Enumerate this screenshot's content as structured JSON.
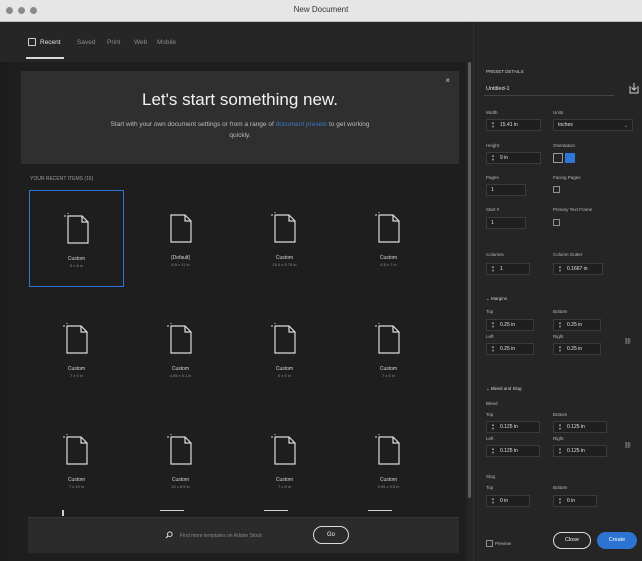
{
  "window": {
    "title": "New Document"
  },
  "tabs": [
    {
      "label": "Recent"
    },
    {
      "label": "Saved"
    },
    {
      "label": "Print"
    },
    {
      "label": "Web"
    },
    {
      "label": "Mobile"
    }
  ],
  "hero": {
    "title": "Let's start something new.",
    "subtitle_before_link": "Start with your own document settings or from a range of ",
    "subtitle_link": "document presets",
    "subtitle_after_link": " to get working quickly."
  },
  "recent": {
    "heading": "YOUR RECENT ITEMS (16)",
    "items": [
      {
        "name": "Custom",
        "size": "5 x 6 in"
      },
      {
        "name": "[Default]",
        "size": "8.5 x 11 in"
      },
      {
        "name": "Custom",
        "size": "15.4 x 9.75 in"
      },
      {
        "name": "Custom",
        "size": "8.5 x 7 in"
      },
      {
        "name": "Custom",
        "size": "7 x 9 in"
      },
      {
        "name": "Custom",
        "size": "4.95 x 6.1 in"
      },
      {
        "name": "Custom",
        "size": "6 x 6 in"
      },
      {
        "name": "Custom",
        "size": "7 x 8 in"
      },
      {
        "name": "Custom",
        "size": "7 x 10 in"
      },
      {
        "name": "Custom",
        "size": "10 x 8.5 in"
      },
      {
        "name": "Custom",
        "size": "7 x 8 in"
      },
      {
        "name": "Custom",
        "size": "5.95 x 9.5 in"
      }
    ]
  },
  "search": {
    "placeholder": "Find more templates on Adobe Stock",
    "go_label": "Go"
  },
  "preset": {
    "heading": "PRESET DETAILS",
    "name": "Untitled-1",
    "width_label": "Width",
    "width": "15.41 in",
    "units_label": "Units",
    "units": "Inches",
    "height_label": "Height",
    "height": "9 in",
    "orientation_label": "Orientation",
    "pages_label": "Pages",
    "pages": "1",
    "facing_label": "Facing Pages",
    "start_label": "Start #",
    "start": "1",
    "primary_label": "Primary Text Frame",
    "columns_label": "Columns",
    "columns": "1",
    "gutter_label": "Column Gutter",
    "gutter": "0.1667 in",
    "margins_section": "Margins",
    "m_top_label": "Top",
    "m_top": "0.25 in",
    "m_bottom_label": "Bottom",
    "m_bottom": "0.25 in",
    "m_left_label": "Left",
    "m_left": "0.25 in",
    "m_right_label": "Right",
    "m_right": "0.25 in",
    "bleed_section": "Bleed and Slug",
    "bleed_label": "Bleed",
    "b_top_label": "Top",
    "b_top": "0.125 in",
    "b_bottom_label": "Bottom",
    "b_bottom": "0.125 in",
    "b_left_label": "Left",
    "b_left": "0.125 in",
    "b_right_label": "Right",
    "b_right": "0.125 in",
    "slug_label": "Slug",
    "s_top_label": "Top",
    "s_top": "0 in",
    "s_bottom_label": "Bottom",
    "s_bottom": "0 in"
  },
  "footer": {
    "preview_label": "Preview",
    "close_label": "Close",
    "create_label": "Create"
  }
}
